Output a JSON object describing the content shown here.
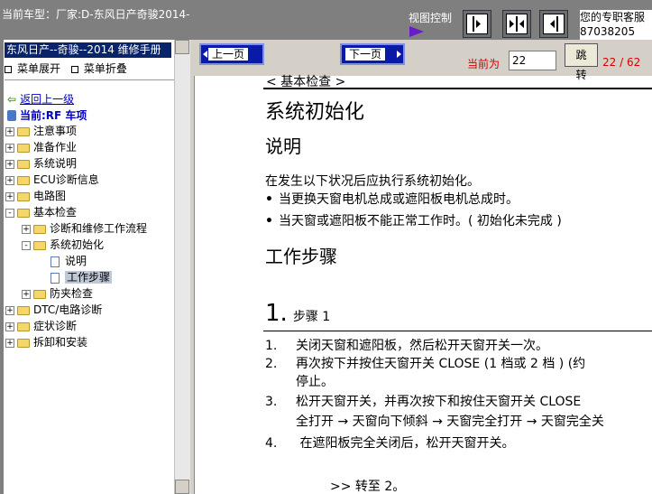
{
  "header": {
    "car_label": "当前车型：厂家:D-东风日产奇骏2014-",
    "view_control_label": "视图控制",
    "consult_line1": "您的专职客服",
    "consult_line2": "87038205"
  },
  "sidebar": {
    "manual_title": "东风日产--奇骏--2014 维修手册",
    "expand_label": "菜单展开",
    "collapse_label": "菜单折叠",
    "back_label": "返回上一级",
    "current_label": "当前:RF 车项",
    "tree": [
      {
        "label": "注意事项",
        "toggle": "+"
      },
      {
        "label": "准备作业",
        "toggle": "+"
      },
      {
        "label": "系统说明",
        "toggle": "+"
      },
      {
        "label": "ECU诊断信息",
        "toggle": "+"
      },
      {
        "label": "电路图",
        "toggle": "+"
      },
      {
        "label": "基本检查",
        "toggle": "-"
      },
      {
        "label": "诊断和维修工作流程",
        "toggle": "+"
      },
      {
        "label": "系统初始化",
        "toggle": "-"
      },
      {
        "label": "说明",
        "toggle": ""
      },
      {
        "label": "工作步骤",
        "toggle": ""
      },
      {
        "label": "防夹检查",
        "toggle": "+"
      },
      {
        "label": "DTC/电路诊断",
        "toggle": "+"
      },
      {
        "label": "症状诊断",
        "toggle": "+"
      },
      {
        "label": "拆卸和安装",
        "toggle": "+"
      }
    ]
  },
  "toolbar": {
    "prev_label": "上一页",
    "next_label": "下一页",
    "current_page_label": "当前为",
    "current_page_value": "22",
    "jump_label": "跳转",
    "page_count": "22 / 62"
  },
  "document": {
    "section": "< 基本检查 >",
    "title": "系统初始化",
    "description_heading": "说明",
    "intro": "在发生以下状况后应执行系统初始化。",
    "bullets": [
      "当更换天窗电机总成或遮阳板电机总成时。",
      "当天窗或遮阳板不能正常工作时。( 初始化未完成 )"
    ],
    "procedure_heading": "工作步骤",
    "step_number": "1.",
    "step_title": "步骤 1",
    "steps": [
      {
        "num": "1.",
        "lines": [
          "关闭天窗和遮阳板，然后松开天窗开关一次。"
        ]
      },
      {
        "num": "2.",
        "lines": [
          "再次按下并按住天窗开关 CLOSE (1 档或 2 档 ) (约",
          "停止。"
        ]
      },
      {
        "num": "3.",
        "lines": [
          "松开天窗开关，并再次按下和按住天窗开关 CLOSE",
          "全打开 → 天窗向下倾斜 → 天窗完全打开 → 天窗完全关"
        ]
      },
      {
        "num": "4.",
        "lines": [
          " 在遮阳板完全关闭后，松开天窗开关。"
        ]
      }
    ],
    "goto": ">> 转至 2。"
  }
}
